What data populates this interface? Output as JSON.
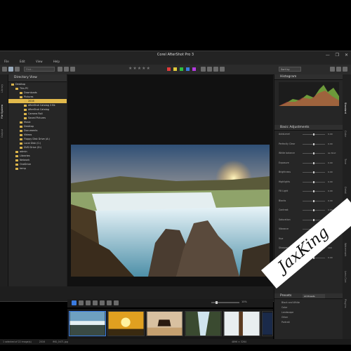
{
  "window": {
    "title": "Corel AfterShot Pro 3",
    "controls": [
      "—",
      "❐",
      "✕"
    ]
  },
  "menu": [
    "File",
    "Edit",
    "View",
    "Help"
  ],
  "toolbar": {
    "search_placeholder": "Find...",
    "rating_stars": "★★★★★",
    "sort_label": "Sort by"
  },
  "swatches": [
    "#e03a3a",
    "#e0c93a",
    "#2fbf43",
    "#3a7be0",
    "#b43ae0"
  ],
  "left_tabs": [
    "Library",
    "File System",
    "Output"
  ],
  "directory": {
    "header": "Directory View",
    "items": [
      {
        "label": "Desktop",
        "level": 0
      },
      {
        "label": "This PC",
        "level": 1
      },
      {
        "label": "Downloads",
        "level": 2
      },
      {
        "label": "Pictures",
        "level": 2
      },
      {
        "label": "2016",
        "level": 3,
        "selected": true
      },
      {
        "label": "AfterShot Catalog 3 Bk",
        "level": 3
      },
      {
        "label": "AfterShot Catalog",
        "level": 3
      },
      {
        "label": "Camera Roll",
        "level": 3
      },
      {
        "label": "Saved Pictures",
        "level": 3
      },
      {
        "label": "Music",
        "level": 2
      },
      {
        "label": "Desktop",
        "level": 2
      },
      {
        "label": "Documents",
        "level": 2
      },
      {
        "label": "Videos",
        "level": 2
      },
      {
        "label": "Floppy Disk Drive (A:)",
        "level": 2
      },
      {
        "label": "Local Disk (C:)",
        "level": 2
      },
      {
        "label": "DVD Drive (D:)",
        "level": 2
      },
      {
        "label": "admin",
        "level": 1
      },
      {
        "label": "Libraries",
        "level": 1
      },
      {
        "label": "Network",
        "level": 1
      },
      {
        "label": "OneDrive",
        "level": 1
      },
      {
        "label": "temp",
        "level": 1
      }
    ]
  },
  "viewer": {
    "zoom_text": "10%"
  },
  "thumbnails": [
    "waterfall",
    "sunset-rocks",
    "horse-beach",
    "waterfall-cave",
    "snow-forest",
    "night-sky"
  ],
  "right_panel": {
    "histogram_title": "Histogram",
    "basic_title": "Basic Adjustments",
    "adjustments": [
      {
        "label": "AutoLevel",
        "value": "0.00"
      },
      {
        "label": "Perfectly Clear",
        "value": "0.00"
      },
      {
        "label": "White balance",
        "value": "As Shot"
      },
      {
        "label": "Exposure",
        "value": "0.00"
      },
      {
        "label": "Brightness",
        "value": "0.00"
      },
      {
        "label": "Highlights",
        "value": "0.00"
      },
      {
        "label": "Fill Light",
        "value": "0.00"
      },
      {
        "label": "Blacks",
        "value": "0.00"
      },
      {
        "label": "Contrast",
        "value": "0.00"
      },
      {
        "label": "Saturation",
        "value": "0.00"
      },
      {
        "label": "Vibrance",
        "value": "0.00"
      },
      {
        "label": "Hue",
        "value": "0.00"
      },
      {
        "label": "Sharpening",
        "value": "100"
      },
      {
        "label": "Noise",
        "value": "0.00"
      }
    ],
    "keywords_label": "Keywords",
    "presets_title": "Presets",
    "presets_filter": "All Presets",
    "presets": [
      "Black and White",
      "Color",
      "Landscape",
      "Other",
      "Portrait"
    ]
  },
  "right_tabs": [
    "Standard",
    "Color",
    "Tone",
    "Detail",
    "Metadata",
    "Watermark",
    "Lens Corr.",
    "Plugins"
  ],
  "status": {
    "left": "1 selected of 22 image(s)",
    "folder": "2016",
    "file": "IMG_0471.jpg",
    "right": "4896 × 3264"
  },
  "watermark_text": "JaxKing"
}
